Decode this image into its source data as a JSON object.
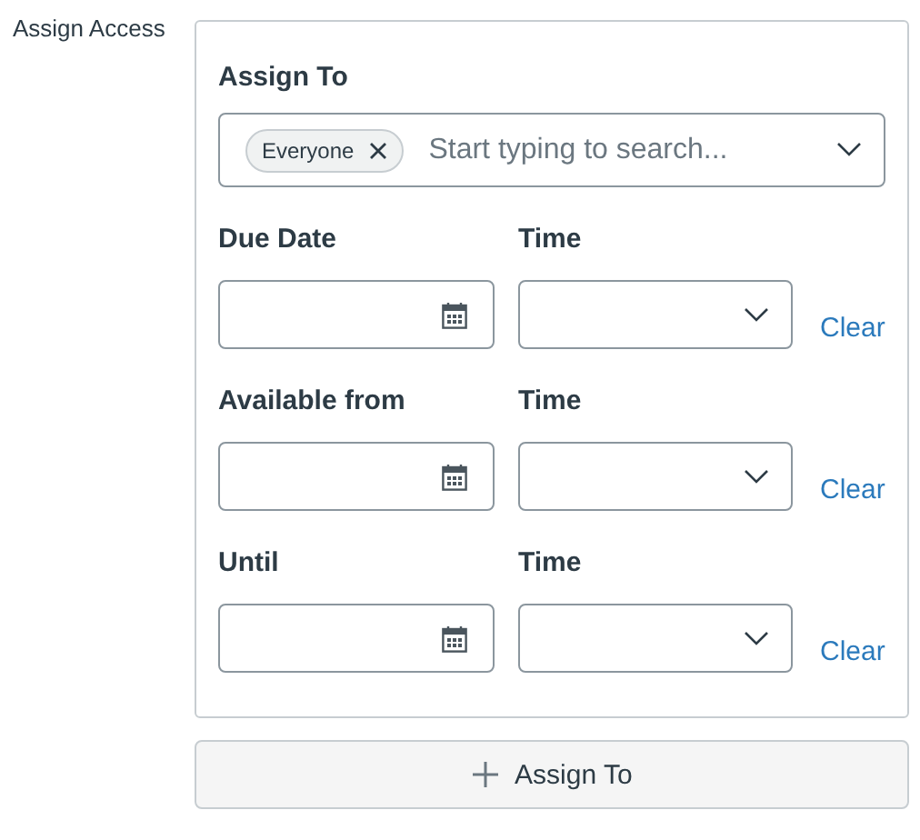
{
  "section_label": "Assign Access",
  "assign_to": {
    "label": "Assign To",
    "tags": [
      "Everyone"
    ],
    "placeholder": "Start typing to search..."
  },
  "date_rows": [
    {
      "date_label": "Due Date",
      "time_label": "Time",
      "clear": "Clear"
    },
    {
      "date_label": "Available from",
      "time_label": "Time",
      "clear": "Clear"
    },
    {
      "date_label": "Until",
      "time_label": "Time",
      "clear": "Clear"
    }
  ],
  "add_button": {
    "label": "Assign To"
  }
}
